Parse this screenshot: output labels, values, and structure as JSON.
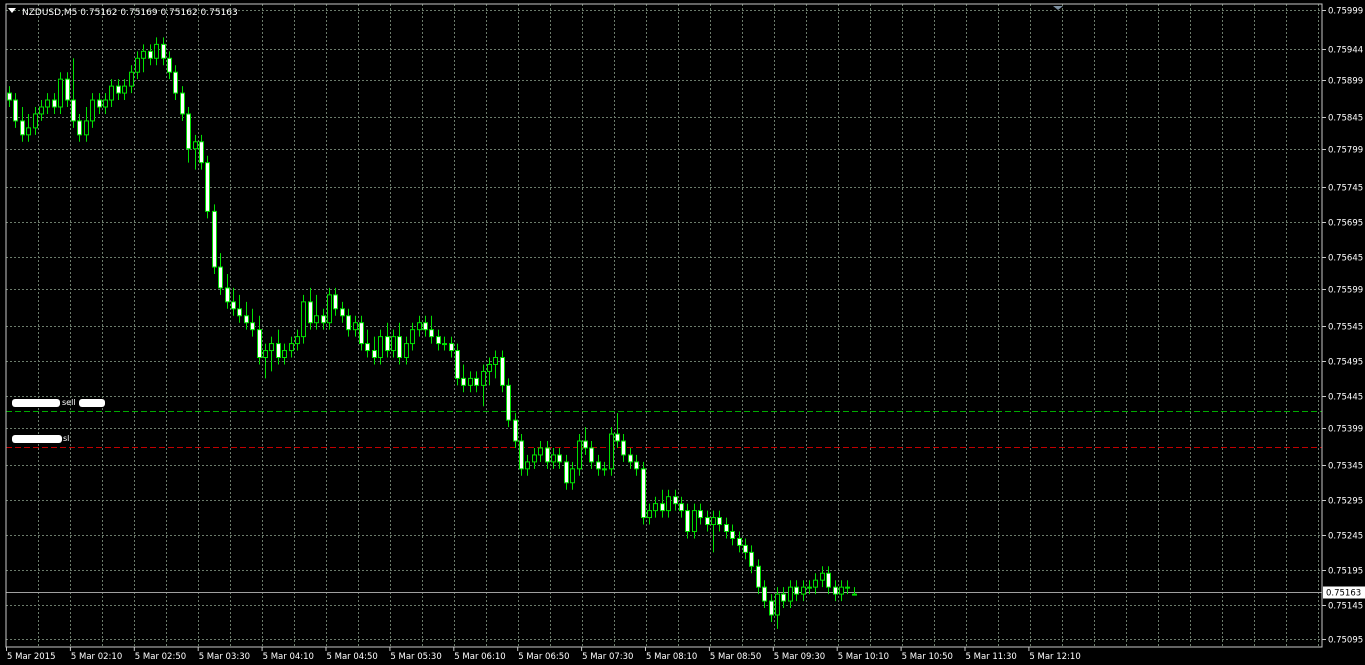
{
  "header": {
    "symbol": "NZDUSD,M5",
    "ohlc": "0.75162 0.75169 0.75162 0.75163"
  },
  "colors": {
    "background": "#000000",
    "grid": "#6b7b6b",
    "foreground": "#ffffff",
    "bull_candle": "#000000",
    "bear_candle": "#ffffff",
    "wick": "#00e000",
    "sell_line": "#00aa00",
    "sl_line": "#c00000",
    "bid_line": "#a0a0a0"
  },
  "objects": {
    "sell_label": "sell",
    "sl_label": "sl"
  },
  "chart_data": {
    "type": "candlestick",
    "symbol": "NZDUSD",
    "timeframe": "M5",
    "price_range": [
      0.75084,
      0.76008
    ],
    "price_ticks": [
      "0.75999",
      "0.75944",
      "0.75899",
      "0.75845",
      "0.75799",
      "0.75745",
      "0.75695",
      "0.75645",
      "0.75599",
      "0.75545",
      "0.75495",
      "0.75445",
      "0.75399",
      "0.75345",
      "0.75295",
      "0.75245",
      "0.75195",
      "0.75145",
      "0.75095"
    ],
    "time_ticks": [
      "5 Mar 2015",
      "5 Mar 02:10",
      "5 Mar 02:50",
      "5 Mar 03:30",
      "5 Mar 04:10",
      "5 Mar 04:50",
      "5 Mar 05:30",
      "5 Mar 06:10",
      "5 Mar 06:50",
      "5 Mar 07:30",
      "5 Mar 08:10",
      "5 Mar 08:50",
      "5 Mar 09:30",
      "5 Mar 10:10",
      "5 Mar 10:50",
      "5 Mar 11:30",
      "5 Mar 12:10"
    ],
    "current_price": "0.75163",
    "sell_level": 0.75423,
    "sl_level": 0.75372,
    "candles": [
      [
        0.7588,
        0.7589,
        0.7586,
        0.7587
      ],
      [
        0.7587,
        0.7588,
        0.7583,
        0.7584
      ],
      [
        0.7584,
        0.7586,
        0.7581,
        0.7582
      ],
      [
        0.7582,
        0.7585,
        0.7581,
        0.7583
      ],
      [
        0.7583,
        0.7586,
        0.7582,
        0.7585
      ],
      [
        0.7585,
        0.7587,
        0.7584,
        0.7586
      ],
      [
        0.7586,
        0.7588,
        0.7585,
        0.7587
      ],
      [
        0.7587,
        0.7588,
        0.7585,
        0.7586
      ],
      [
        0.7586,
        0.7591,
        0.7585,
        0.759
      ],
      [
        0.759,
        0.7591,
        0.7586,
        0.7587
      ],
      [
        0.7587,
        0.7593,
        0.7583,
        0.7584
      ],
      [
        0.7584,
        0.7585,
        0.7581,
        0.7582
      ],
      [
        0.7582,
        0.7586,
        0.7581,
        0.7584
      ],
      [
        0.7584,
        0.7588,
        0.7583,
        0.7587
      ],
      [
        0.7587,
        0.7588,
        0.7585,
        0.7586
      ],
      [
        0.7586,
        0.7588,
        0.7585,
        0.7587
      ],
      [
        0.7587,
        0.759,
        0.7586,
        0.7589
      ],
      [
        0.7589,
        0.759,
        0.7587,
        0.7588
      ],
      [
        0.7588,
        0.759,
        0.7587,
        0.7589
      ],
      [
        0.7589,
        0.7592,
        0.7588,
        0.7591
      ],
      [
        0.7591,
        0.7594,
        0.759,
        0.7593
      ],
      [
        0.7593,
        0.7595,
        0.7591,
        0.7594
      ],
      [
        0.7594,
        0.7595,
        0.7592,
        0.7593
      ],
      [
        0.7593,
        0.7596,
        0.7592,
        0.7595
      ],
      [
        0.7595,
        0.7596,
        0.7592,
        0.7593
      ],
      [
        0.7593,
        0.7594,
        0.759,
        0.7591
      ],
      [
        0.7591,
        0.7592,
        0.7587,
        0.7588
      ],
      [
        0.7588,
        0.7589,
        0.7584,
        0.7585
      ],
      [
        0.7585,
        0.7586,
        0.7578,
        0.758
      ],
      [
        0.758,
        0.7582,
        0.7577,
        0.7581
      ],
      [
        0.7581,
        0.7582,
        0.7577,
        0.7578
      ],
      [
        0.7578,
        0.7579,
        0.757,
        0.7571
      ],
      [
        0.7571,
        0.7572,
        0.7562,
        0.7563
      ],
      [
        0.7563,
        0.7565,
        0.7559,
        0.756
      ],
      [
        0.756,
        0.7562,
        0.7557,
        0.7558
      ],
      [
        0.7558,
        0.756,
        0.7556,
        0.7557
      ],
      [
        0.7557,
        0.7559,
        0.7555,
        0.7556
      ],
      [
        0.7556,
        0.7558,
        0.7554,
        0.7555
      ],
      [
        0.7555,
        0.7557,
        0.7553,
        0.7554
      ],
      [
        0.7554,
        0.7556,
        0.7549,
        0.755
      ],
      [
        0.755,
        0.7552,
        0.7547,
        0.7551
      ],
      [
        0.7551,
        0.7553,
        0.7548,
        0.7552
      ],
      [
        0.7552,
        0.7554,
        0.7549,
        0.755
      ],
      [
        0.755,
        0.7552,
        0.7549,
        0.7551
      ],
      [
        0.7551,
        0.7553,
        0.755,
        0.7552
      ],
      [
        0.7552,
        0.7554,
        0.7551,
        0.7553
      ],
      [
        0.7553,
        0.7559,
        0.7552,
        0.7558
      ],
      [
        0.7558,
        0.756,
        0.7554,
        0.7555
      ],
      [
        0.7555,
        0.7559,
        0.7554,
        0.7556
      ],
      [
        0.7556,
        0.7557,
        0.7554,
        0.7555
      ],
      [
        0.7555,
        0.756,
        0.7554,
        0.7559
      ],
      [
        0.7559,
        0.756,
        0.7556,
        0.7557
      ],
      [
        0.7557,
        0.7558,
        0.7555,
        0.7556
      ],
      [
        0.7556,
        0.7557,
        0.7553,
        0.7554
      ],
      [
        0.7554,
        0.7556,
        0.7553,
        0.7555
      ],
      [
        0.7555,
        0.7556,
        0.7551,
        0.7552
      ],
      [
        0.7552,
        0.7554,
        0.755,
        0.7551
      ],
      [
        0.7551,
        0.7553,
        0.7549,
        0.755
      ],
      [
        0.755,
        0.7554,
        0.7549,
        0.7553
      ],
      [
        0.7553,
        0.7555,
        0.755,
        0.7551
      ],
      [
        0.7551,
        0.7554,
        0.755,
        0.7553
      ],
      [
        0.7553,
        0.7555,
        0.7549,
        0.755
      ],
      [
        0.755,
        0.7553,
        0.7549,
        0.7552
      ],
      [
        0.7552,
        0.7555,
        0.7551,
        0.7554
      ],
      [
        0.7554,
        0.7556,
        0.7553,
        0.7555
      ],
      [
        0.7555,
        0.7556,
        0.7553,
        0.7554
      ],
      [
        0.7554,
        0.7556,
        0.7552,
        0.7553
      ],
      [
        0.7553,
        0.7554,
        0.7551,
        0.7552
      ],
      [
        0.7552,
        0.7553,
        0.7551,
        0.7552
      ],
      [
        0.7552,
        0.7553,
        0.755,
        0.7551
      ],
      [
        0.7551,
        0.7552,
        0.7546,
        0.7547
      ],
      [
        0.7547,
        0.7549,
        0.7545,
        0.7546
      ],
      [
        0.7546,
        0.7548,
        0.7545,
        0.7547
      ],
      [
        0.7547,
        0.7548,
        0.7545,
        0.7546
      ],
      [
        0.7546,
        0.7549,
        0.7543,
        0.7548
      ],
      [
        0.7548,
        0.755,
        0.7546,
        0.7549
      ],
      [
        0.7549,
        0.7551,
        0.7547,
        0.755
      ],
      [
        0.755,
        0.7551,
        0.7545,
        0.7546
      ],
      [
        0.7546,
        0.7547,
        0.754,
        0.7541
      ],
      [
        0.7541,
        0.7542,
        0.7537,
        0.7538
      ],
      [
        0.7538,
        0.7539,
        0.7533,
        0.7534
      ],
      [
        0.7534,
        0.7536,
        0.7533,
        0.7535
      ],
      [
        0.7535,
        0.7537,
        0.7534,
        0.7536
      ],
      [
        0.7536,
        0.7538,
        0.7535,
        0.7537
      ],
      [
        0.7537,
        0.7538,
        0.7534,
        0.7535
      ],
      [
        0.7535,
        0.7537,
        0.7534,
        0.7536
      ],
      [
        0.7536,
        0.7537,
        0.7534,
        0.7535
      ],
      [
        0.7535,
        0.7536,
        0.7531,
        0.7532
      ],
      [
        0.7532,
        0.7535,
        0.7531,
        0.7534
      ],
      [
        0.7534,
        0.7539,
        0.7533,
        0.7538
      ],
      [
        0.7538,
        0.754,
        0.7536,
        0.7537
      ],
      [
        0.7537,
        0.7538,
        0.7534,
        0.7535
      ],
      [
        0.7535,
        0.7536,
        0.7533,
        0.7534
      ],
      [
        0.7534,
        0.7535,
        0.7533,
        0.7534
      ],
      [
        0.7534,
        0.754,
        0.7533,
        0.7539
      ],
      [
        0.7539,
        0.7542,
        0.7537,
        0.7538
      ],
      [
        0.7538,
        0.7539,
        0.7535,
        0.7536
      ],
      [
        0.7536,
        0.7537,
        0.7534,
        0.7535
      ],
      [
        0.7535,
        0.7536,
        0.7533,
        0.7534
      ],
      [
        0.7534,
        0.7535,
        0.7526,
        0.7527
      ],
      [
        0.7527,
        0.7529,
        0.7526,
        0.7528
      ],
      [
        0.7528,
        0.753,
        0.7527,
        0.7529
      ],
      [
        0.7529,
        0.7531,
        0.7527,
        0.7528
      ],
      [
        0.7528,
        0.7531,
        0.7527,
        0.753
      ],
      [
        0.753,
        0.7531,
        0.7528,
        0.7529
      ],
      [
        0.7529,
        0.753,
        0.7527,
        0.7528
      ],
      [
        0.7528,
        0.7529,
        0.7524,
        0.7525
      ],
      [
        0.7525,
        0.7529,
        0.7524,
        0.7528
      ],
      [
        0.7528,
        0.7529,
        0.7526,
        0.7527
      ],
      [
        0.7527,
        0.7528,
        0.7525,
        0.7526
      ],
      [
        0.7526,
        0.7528,
        0.7522,
        0.7527
      ],
      [
        0.7527,
        0.7528,
        0.7525,
        0.7526
      ],
      [
        0.7526,
        0.7527,
        0.7524,
        0.7525
      ],
      [
        0.7525,
        0.7526,
        0.7523,
        0.7524
      ],
      [
        0.7524,
        0.7525,
        0.7522,
        0.7523
      ],
      [
        0.7523,
        0.7524,
        0.7521,
        0.7522
      ],
      [
        0.7522,
        0.7523,
        0.7519,
        0.752
      ],
      [
        0.752,
        0.7521,
        0.7516,
        0.7517
      ],
      [
        0.7517,
        0.7518,
        0.7514,
        0.7515
      ],
      [
        0.7515,
        0.7516,
        0.7512,
        0.7513
      ],
      [
        0.7513,
        0.7517,
        0.7511,
        0.7516
      ],
      [
        0.7516,
        0.7517,
        0.7514,
        0.7515
      ],
      [
        0.7515,
        0.7518,
        0.7514,
        0.7517
      ],
      [
        0.7517,
        0.7518,
        0.7515,
        0.7516
      ],
      [
        0.7516,
        0.7518,
        0.7515,
        0.7517
      ],
      [
        0.7517,
        0.7518,
        0.7516,
        0.7517
      ],
      [
        0.7517,
        0.7519,
        0.7516,
        0.7518
      ],
      [
        0.7518,
        0.752,
        0.7517,
        0.7519
      ],
      [
        0.7519,
        0.752,
        0.7516,
        0.7517
      ],
      [
        0.7517,
        0.7518,
        0.7515,
        0.7516
      ],
      [
        0.7516,
        0.7518,
        0.7515,
        0.7517
      ],
      [
        0.7517,
        0.7518,
        0.7516,
        0.7517
      ],
      [
        0.7516,
        0.7517,
        0.7516,
        0.7516
      ]
    ]
  }
}
